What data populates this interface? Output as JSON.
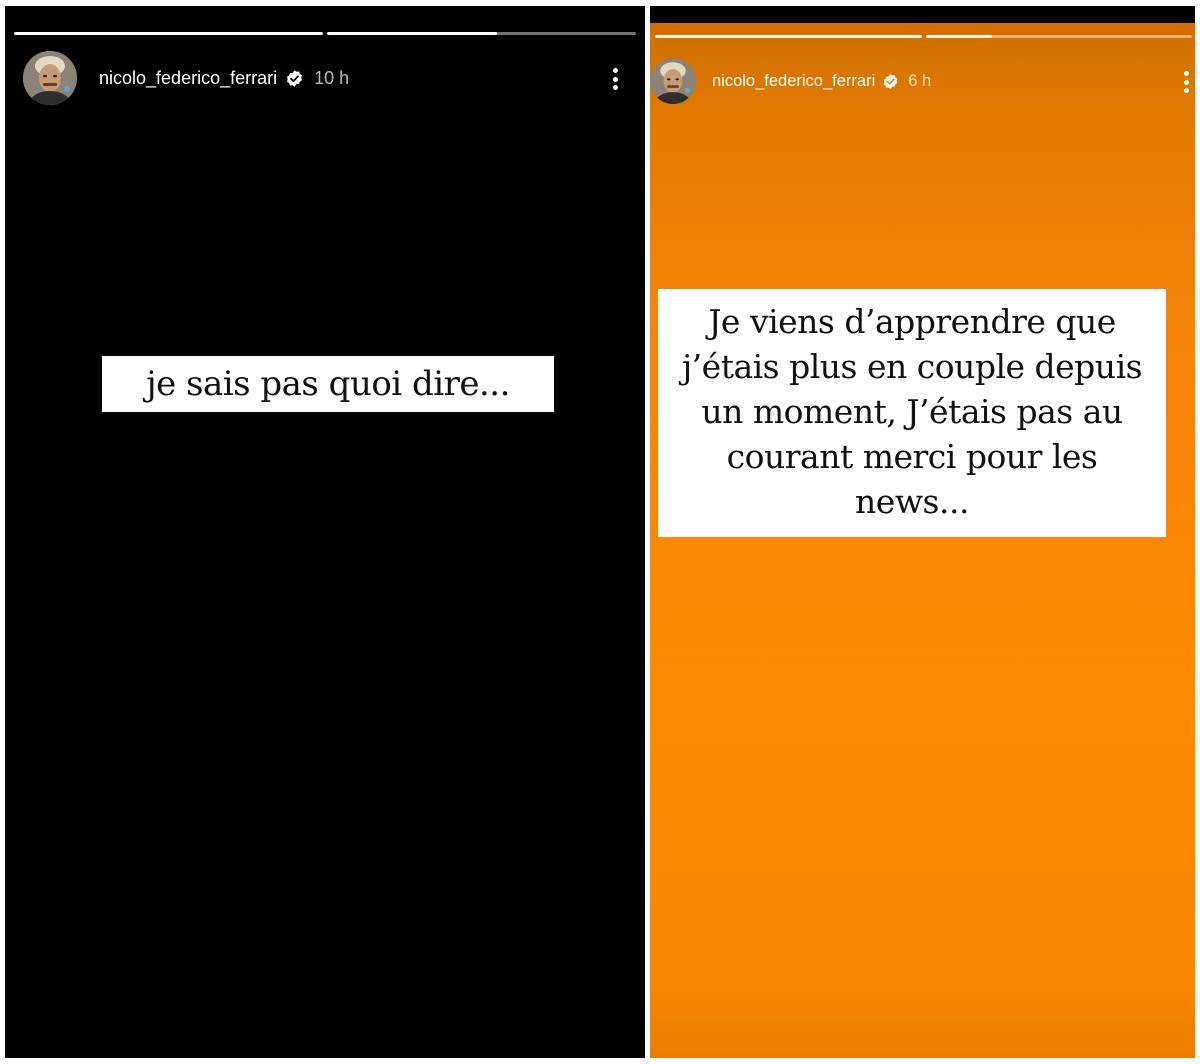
{
  "stories": [
    {
      "username": "nicolo_federico_ferrari",
      "verified": true,
      "timestamp": "10 h",
      "background": "#000000",
      "progress": [
        1,
        0.55
      ],
      "caption": "je sais pas quoi dire..."
    },
    {
      "username": "nicolo_federico_ferrari",
      "verified": true,
      "timestamp": "6 h",
      "background": "#ff8a00",
      "progress": [
        1,
        0.25
      ],
      "caption_lines": [
        "Je viens d’apprendre que",
        "j’étais plus en couple depuis",
        "un moment, J’étais pas au",
        "courant merci pour les",
        "news..."
      ]
    }
  ],
  "icons": {
    "avatar": "profile-photo",
    "verified": "verified-badge-icon",
    "more": "more-options-icon"
  }
}
